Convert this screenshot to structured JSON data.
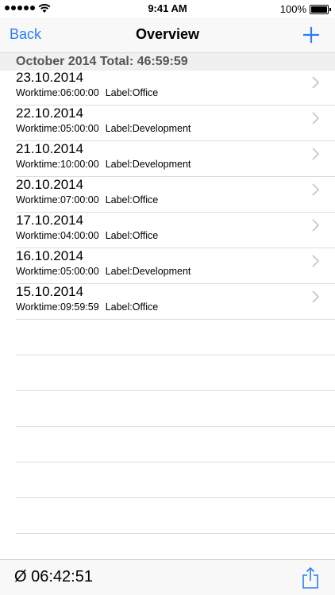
{
  "status_bar": {
    "time": "9:41 AM",
    "battery_percent": "100%",
    "signal_bars": 5
  },
  "nav": {
    "back_label": "Back",
    "title": "Overview",
    "add_icon": "plus-icon",
    "accent_color": "#2a7ff6"
  },
  "section": {
    "title": "October 2014 Total: 46:59:59"
  },
  "entries": [
    {
      "date": "23.10.2014",
      "worktime": "Worktime:06:00:00",
      "label": "Label:Office"
    },
    {
      "date": "22.10.2014",
      "worktime": "Worktime:05:00:00",
      "label": "Label:Development"
    },
    {
      "date": "21.10.2014",
      "worktime": "Worktime:10:00:00",
      "label": "Label:Development"
    },
    {
      "date": "20.10.2014",
      "worktime": "Worktime:07:00:00",
      "label": "Label:Office"
    },
    {
      "date": "17.10.2014",
      "worktime": "Worktime:04:00:00",
      "label": "Label:Office"
    },
    {
      "date": "16.10.2014",
      "worktime": "Worktime:05:00:00",
      "label": "Label:Development"
    },
    {
      "date": "15.10.2014",
      "worktime": "Worktime:09:59:59",
      "label": "Label:Office"
    }
  ],
  "toolbar": {
    "average": "Ø 06:42:51",
    "share_icon": "share-icon"
  }
}
